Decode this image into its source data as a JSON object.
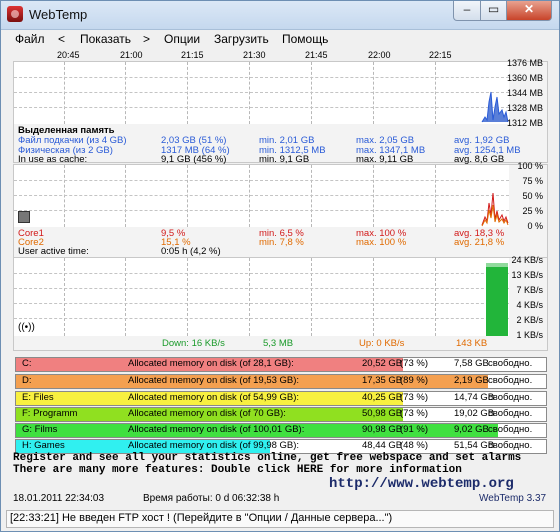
{
  "window": {
    "title": "WebTemp"
  },
  "menu": [
    "Файл",
    "<",
    "Показать",
    ">",
    "Опции",
    "Загрузить",
    "Помощь"
  ],
  "time_ticks": [
    "20:45",
    "21:00",
    "21:15",
    "21:30",
    "21:45",
    "22:00",
    "22:15"
  ],
  "chart1": {
    "y_ticks": [
      "1376 MB",
      "1360 MB",
      "1344 MB",
      "1328 MB",
      "1312 MB"
    ]
  },
  "mem": {
    "header": "Выделенная память",
    "swap": {
      "label": "Файл подкачки (из 4 GB)",
      "cur": "2,03 GB (51 %)",
      "min": "min. 2,01 GB",
      "max": "max. 2,05 GB",
      "avg": "avg. 1,92 GB"
    },
    "phys": {
      "label": "Физическая (из 2 GB)",
      "cur": "1317 MB (64 %)",
      "min": "min. 1312,5 MB",
      "max": "max. 1347,1 MB",
      "avg": "avg. 1254,1 MB"
    },
    "cache": {
      "label": "In use as cache:",
      "cur": "9,1 GB (456 %)",
      "min": "min. 9,1 GB",
      "max": "max. 9,11 GB",
      "avg": "avg. 8,6 GB"
    }
  },
  "chart2": {
    "y_ticks": [
      "100 %",
      "75 %",
      "50 %",
      "25 %",
      "0 %"
    ]
  },
  "cpu": {
    "core1": {
      "label": "Core1",
      "cur": "9,5 %",
      "min": "min. 6,5 %",
      "max": "max. 100 %",
      "avg": "avg. 18,3 %"
    },
    "core2": {
      "label": "Core2",
      "cur": "15,1 %",
      "min": "min. 7,8 %",
      "max": "max. 100 %",
      "avg": "avg. 21,8 %"
    },
    "active_label": "User active time:",
    "active_val": "0:05 h (4,2 %)"
  },
  "chart3": {
    "y_ticks": [
      "24 KB/s",
      "13 KB/s",
      "7 KB/s",
      "4 KB/s",
      "2 KB/s",
      "1 KB/s"
    ]
  },
  "net": {
    "down": "Down: 16 KB/s",
    "down_total": "5,3 MB",
    "up": "Up: 0 KB/s",
    "up_total": "143 KB"
  },
  "disks": [
    {
      "name": "C:",
      "alloc": "Allocated memory on disk (of 28,1 GB):",
      "used": "20,52 GB",
      "pct": "(73 %)",
      "free": "7,58 GB",
      "free_label": "свободно.",
      "color": "#f08080",
      "fill": 0.73
    },
    {
      "name": "D:",
      "alloc": "Allocated memory on disk (of 19,53 GB):",
      "used": "17,35 GB",
      "pct": "(89 %)",
      "free": "2,19 GB",
      "free_label": "свободно.",
      "color": "#f4a050",
      "fill": 0.89
    },
    {
      "name": "E: Files",
      "alloc": "Allocated memory on disk (of 54,99 GB):",
      "used": "40,25 GB",
      "pct": "(73 %)",
      "free": "14,74 GB",
      "free_label": "свободно.",
      "color": "#f8f040",
      "fill": 0.73
    },
    {
      "name": "F: Programm",
      "alloc": "Allocated memory on disk (of 70 GB):",
      "used": "50,98 GB",
      "pct": "(73 %)",
      "free": "19,02 GB",
      "free_label": "свободно.",
      "color": "#90e020",
      "fill": 0.73
    },
    {
      "name": "G: Films",
      "alloc": "Allocated memory on disk (of 100,01 GB):",
      "used": "90,98 GB",
      "pct": "(91 %)",
      "free": "9,02 GB",
      "free_label": "свободно.",
      "color": "#40e040",
      "fill": 0.91
    },
    {
      "name": "H: Games",
      "alloc": "Allocated memory on disk (of 99,98 GB):",
      "used": "48,44 GB",
      "pct": "(48 %)",
      "free": "51,54 GB",
      "free_label": "свободно.",
      "color": "#30f0f0",
      "fill": 0.48
    }
  ],
  "promo": {
    "line1": "Register and see all your statistics online, get free webspace and set alarms",
    "line2": "There are many more features: Double click HERE for more information",
    "url": "http://www.webtemp.org"
  },
  "footer": {
    "datetime": "18.01.2011 22:34:03",
    "uptime": "Время работы: 0 d 06:32:38 h",
    "version": "WebTemp 3.37"
  },
  "statusbar": "[22:33:21] Не введен FTP хост ! (Перейдите в \"Опции / Данные сервера...\")",
  "colors": {
    "core1": "#d21a1a",
    "core2": "#e06a00",
    "mem": "#2a5bd7",
    "net": "#1a9a2a"
  }
}
